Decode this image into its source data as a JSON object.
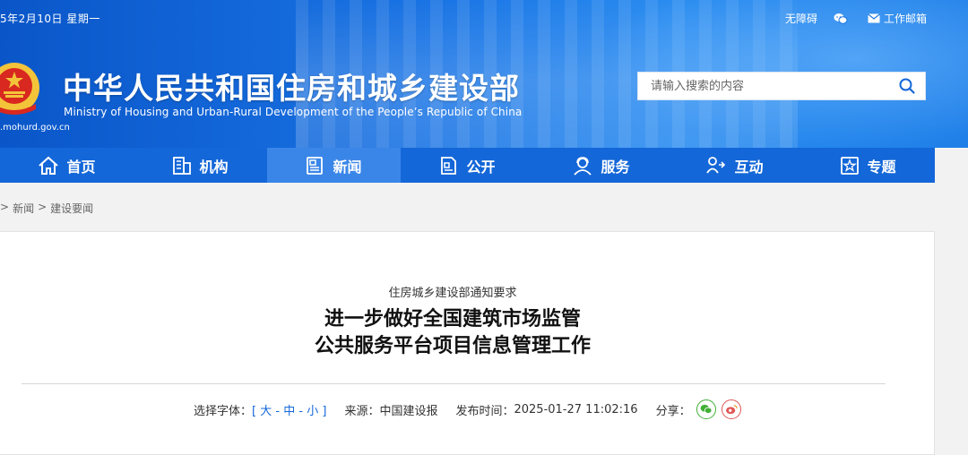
{
  "header": {
    "date": "5年2月10日 星期一",
    "links": [
      {
        "label": "无障碍",
        "icon": "accessibility-link"
      },
      {
        "label": "",
        "icon": "wechat-icon"
      },
      {
        "label": "工作邮箱",
        "icon": "mail-icon"
      }
    ],
    "title": "中华人民共和国住房和城乡建设部",
    "subtitle": "Ministry of Housing and Urban-Rural Development of the People’s Republic of China",
    "domain": ".mohurd.gov.cn"
  },
  "search": {
    "placeholder": "请输入搜索的内容"
  },
  "nav": {
    "items": [
      {
        "label": "首页",
        "icon": "home-icon"
      },
      {
        "label": "机构",
        "icon": "building-icon"
      },
      {
        "label": "新闻",
        "icon": "newspaper-icon"
      },
      {
        "label": "公开",
        "icon": "document-icon"
      },
      {
        "label": "服务",
        "icon": "service-icon"
      },
      {
        "label": "互动",
        "icon": "interaction-icon"
      },
      {
        "label": "专题",
        "icon": "star-icon"
      }
    ],
    "active": "新闻"
  },
  "breadcrumb": {
    "sep": ">",
    "items": [
      "新闻",
      "建设要闻"
    ]
  },
  "article": {
    "kicker": "住房城乡建设部通知要求",
    "title_line1": "进一步做好全国建筑市场监管",
    "title_line2": "公共服务平台项目信息管理工作",
    "font_size_label": "选择字体：",
    "font_sizes": [
      "大",
      "中",
      "小"
    ],
    "source_label": "来源：",
    "source": "中国建设报",
    "time_label": "发布时间：",
    "time": "2025-01-27 11:02:16",
    "share_label": "分享："
  },
  "colors": {
    "nav": "#1467d8",
    "nav_active": "#3a86e8",
    "header": "#1a74e4"
  }
}
